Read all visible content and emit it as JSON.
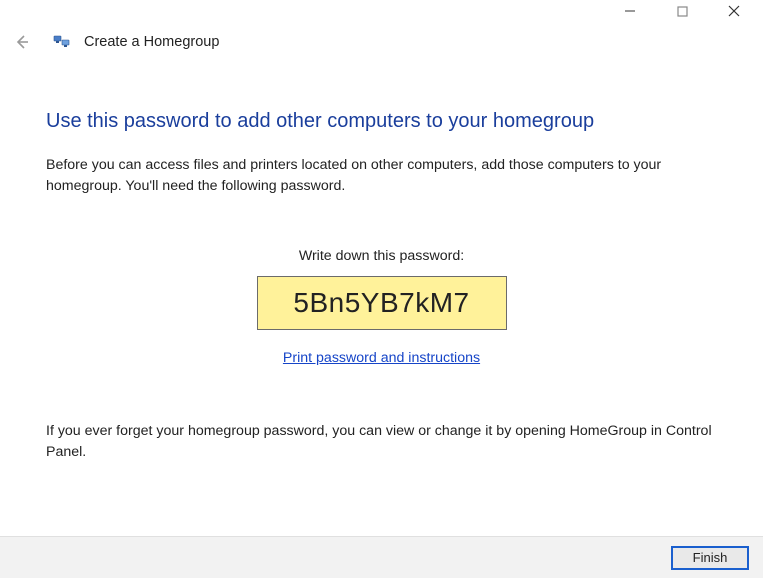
{
  "window": {
    "wizard_title": "Create a Homegroup"
  },
  "content": {
    "headline": "Use this password to add other computers to your homegroup",
    "intro": "Before you can access files and printers located on other computers, add those computers to your homegroup. You'll need the following password.",
    "password_label": "Write down this password:",
    "password": "5Bn5YB7kM7",
    "print_link": "Print password and instructions",
    "footer_note": "If you ever forget your homegroup password, you can view or change it by opening HomeGroup in Control Panel."
  },
  "buttons": {
    "finish": "Finish"
  }
}
